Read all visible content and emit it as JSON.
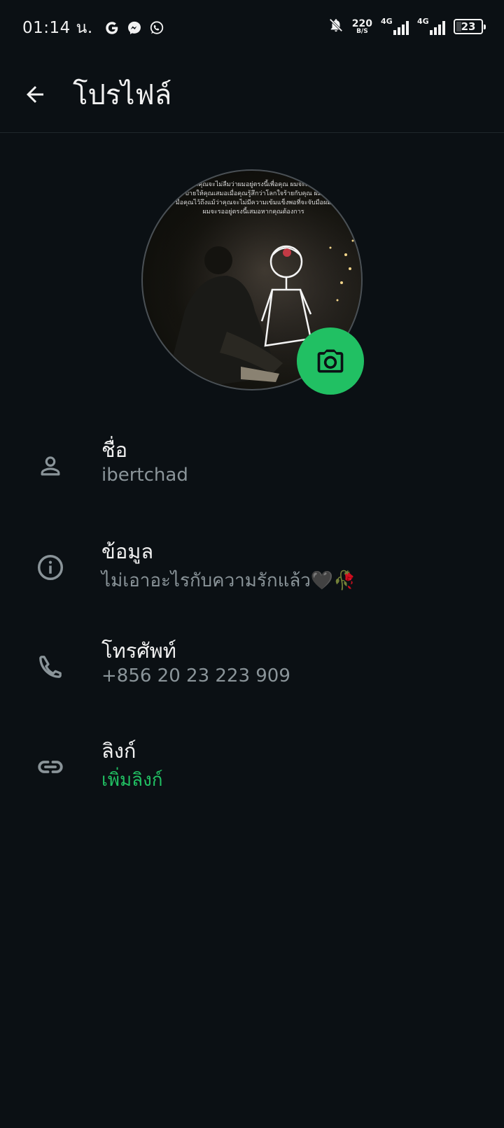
{
  "status_bar": {
    "time": "01:14 น.",
    "apps": [
      "google-icon",
      "messenger-icon",
      "whatsapp-icon"
    ],
    "net_speed_value": "220",
    "net_speed_unit": "B/S",
    "sim1_label": "4G",
    "sim2_label": "4G",
    "battery": "23"
  },
  "header": {
    "title": "โปรไฟล์"
  },
  "avatar": {
    "overlay_lines": [
      "ว่าคุณจะไม่ลืมว่าผมอยู่ตรงนี้เพื่อคุณ ผมจะเป็น",
      "บ้ายให้คุณเสมอเมื่อคุณรู้สึกว่าโลกใจร้ายกับคุณ ผม",
      "มือคุณไว้ถึงแม้ว่าคุณจะไม่มีความเข้มแข็งพอที่จะจับมือผม",
      "ผมจะรออยู่ตรงนี้เสมอหากคุณต้องการ"
    ]
  },
  "fields": {
    "name": {
      "label": "ชื่อ",
      "value": "ibertchad"
    },
    "about": {
      "label": "ข้อมูล",
      "value": "ไม่เอาอะไรกับความรักแล้ว🖤🥀"
    },
    "phone": {
      "label": "โทรศัพท์",
      "value": "+856 20 23 223 909"
    },
    "links": {
      "label": "ลิงก์",
      "value": "เพิ่มลิงก์"
    }
  },
  "colors": {
    "background": "#0b1014",
    "accent": "#21c063",
    "secondary_text": "#8a9499"
  }
}
